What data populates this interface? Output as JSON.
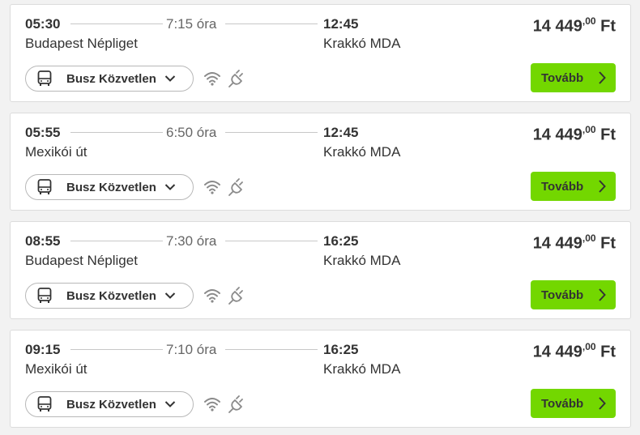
{
  "colors": {
    "accent": "#73d700",
    "text": "#333333",
    "muted": "#666666",
    "border": "#dcdcdc",
    "background": "#f2f2f2"
  },
  "icons": {
    "transport": "bus-icon",
    "dropdown": "chevron-down-icon",
    "amenity_1": "wifi-icon",
    "amenity_2": "power-plug-icon",
    "button": "chevron-right-icon"
  },
  "trips": [
    {
      "departure_time": "05:30",
      "departure_station": "Budapest Népliget",
      "duration": "7:15 óra",
      "arrival_time": "12:45",
      "arrival_station": "Krakkó MDA",
      "price_main": "14 449",
      "price_decimal": ",00",
      "currency": "Ft",
      "transport_label": "Busz Közvetlen",
      "button_label": "Tovább"
    },
    {
      "departure_time": "05:55",
      "departure_station": "Mexikói út",
      "duration": "6:50 óra",
      "arrival_time": "12:45",
      "arrival_station": "Krakkó MDA",
      "price_main": "14 449",
      "price_decimal": ",00",
      "currency": "Ft",
      "transport_label": "Busz Közvetlen",
      "button_label": "Tovább"
    },
    {
      "departure_time": "08:55",
      "departure_station": "Budapest Népliget",
      "duration": "7:30 óra",
      "arrival_time": "16:25",
      "arrival_station": "Krakkó MDA",
      "price_main": "14 449",
      "price_decimal": ",00",
      "currency": "Ft",
      "transport_label": "Busz Közvetlen",
      "button_label": "Tovább"
    },
    {
      "departure_time": "09:15",
      "departure_station": "Mexikói út",
      "duration": "7:10 óra",
      "arrival_time": "16:25",
      "arrival_station": "Krakkó MDA",
      "price_main": "14 449",
      "price_decimal": ",00",
      "currency": "Ft",
      "transport_label": "Busz Közvetlen",
      "button_label": "Tovább"
    }
  ]
}
